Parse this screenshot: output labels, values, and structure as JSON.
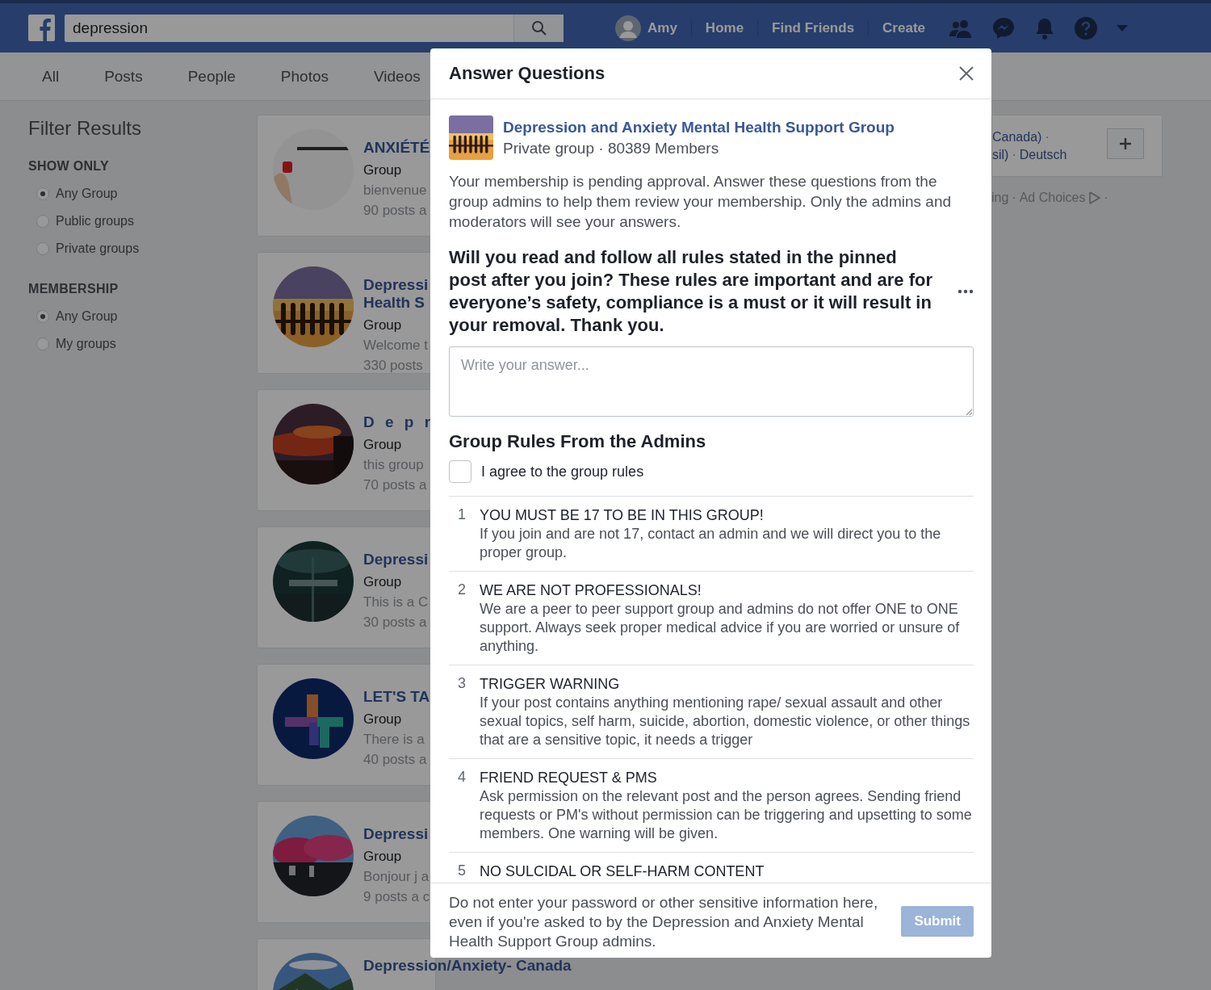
{
  "top_bar": {
    "search": {
      "value": "depression"
    },
    "profile_name": "Amy",
    "nav": [
      "Home",
      "Find Friends",
      "Create"
    ]
  },
  "tabs": [
    "All",
    "Posts",
    "People",
    "Photos",
    "Videos"
  ],
  "filters": {
    "title": "Filter Results",
    "groups": [
      {
        "heading": "SHOW ONLY",
        "options": [
          {
            "label": "Any Group",
            "selected": true
          },
          {
            "label": "Public groups",
            "selected": false
          },
          {
            "label": "Private groups",
            "selected": false
          }
        ]
      },
      {
        "heading": "MEMBERSHIP",
        "options": [
          {
            "label": "Any Group",
            "selected": true
          },
          {
            "label": "My groups",
            "selected": false
          }
        ]
      }
    ]
  },
  "results": [
    {
      "title": "ANXIÉTÉ",
      "type": "Group",
      "description": "bienvenue",
      "posts": "90 posts a"
    },
    {
      "title": "Depressi\nHealth S",
      "type": "Group",
      "description": "Welcome t",
      "posts": "330 posts"
    },
    {
      "title": "D e p r",
      "type": "Group",
      "description": "this group",
      "posts": "70 posts a"
    },
    {
      "title": "Depressi",
      "type": "Group",
      "description": "This is a C",
      "posts": "30 posts a"
    },
    {
      "title": "LET'S TA",
      "type": "Group",
      "description": "There is a",
      "posts": "40 posts a"
    },
    {
      "title": "Depressi",
      "type": "Group",
      "description": "Bonjour j a",
      "posts": "9 posts a c"
    },
    {
      "title": "Depression/Anxiety- Canada"
    }
  ],
  "side_card": {
    "lines": [
      [
        {
          "kind": "link",
          "text": "Canada)"
        },
        {
          "kind": "sep",
          "text": "·"
        }
      ],
      [
        {
          "kind": "link",
          "text": "sil)"
        },
        {
          "kind": "sep",
          "text": "·"
        },
        {
          "kind": "link",
          "text": "Deutsch"
        }
      ]
    ]
  },
  "side_footer": [
    {
      "kind": "link",
      "text": "ing"
    },
    {
      "kind": "sep",
      "text": "·"
    },
    {
      "kind": "link",
      "text": "Ad Choices"
    },
    {
      "kind": "icon"
    },
    {
      "kind": "sep",
      "text": "·"
    }
  ],
  "dialog": {
    "title": "Answer Questions",
    "group": {
      "name": "Depression and Anxiety Mental Health Support Group",
      "meta": "Private group · 80389 Members"
    },
    "intro": "Your membership is pending approval. Answer these questions from the group admins to help them review your membership. Only the admins and moderators will see your answers.",
    "question": "Will you read and follow all rules stated in the pinned post after you join? These rules are important and are for everyone’s safety, compliance is a must or it will result in your removal. Thank you.",
    "answer_placeholder": "Write your answer...",
    "rules_heading": "Group Rules From the Admins",
    "agree": {
      "label": "I agree to the group rules",
      "checked": false
    },
    "rules": [
      {
        "number": "1",
        "title": "YOU MUST BE 17 TO BE IN THIS GROUP!",
        "body": "If you join and are not 17, contact an admin and we will direct you to the proper group."
      },
      {
        "number": "2",
        "title": "WE ARE NOT PROFESSIONALS!",
        "body": "We are a peer to peer support group and admins do not offer ONE to ONE support. Always seek proper medical advice if you are worried or unsure of anything."
      },
      {
        "number": "3",
        "title": "TRIGGER WARNING",
        "body": "If your post contains anything mentioning rape/ sexual assault and other sexual topics, self harm, suicide, abortion, domestic violence, or other things that are a sensitive topic, it needs a trigger"
      },
      {
        "number": "4",
        "title": "FRIEND REQUEST & PMS",
        "body": "Ask permission on the relevant post and the person agrees. Sending friend requests or PM's without permission can be triggering and upsetting to some members. One warning will be given."
      },
      {
        "number": "5",
        "title": "NO SULCIDAL OR SELF-HARM CONTENT"
      }
    ],
    "notice": "Do not enter your password or other sensitive information here, even if you're asked to by the Depression and Anxiety Mental Health Support Group admins.",
    "submit": {
      "label": "Submit",
      "disabled": true
    }
  }
}
